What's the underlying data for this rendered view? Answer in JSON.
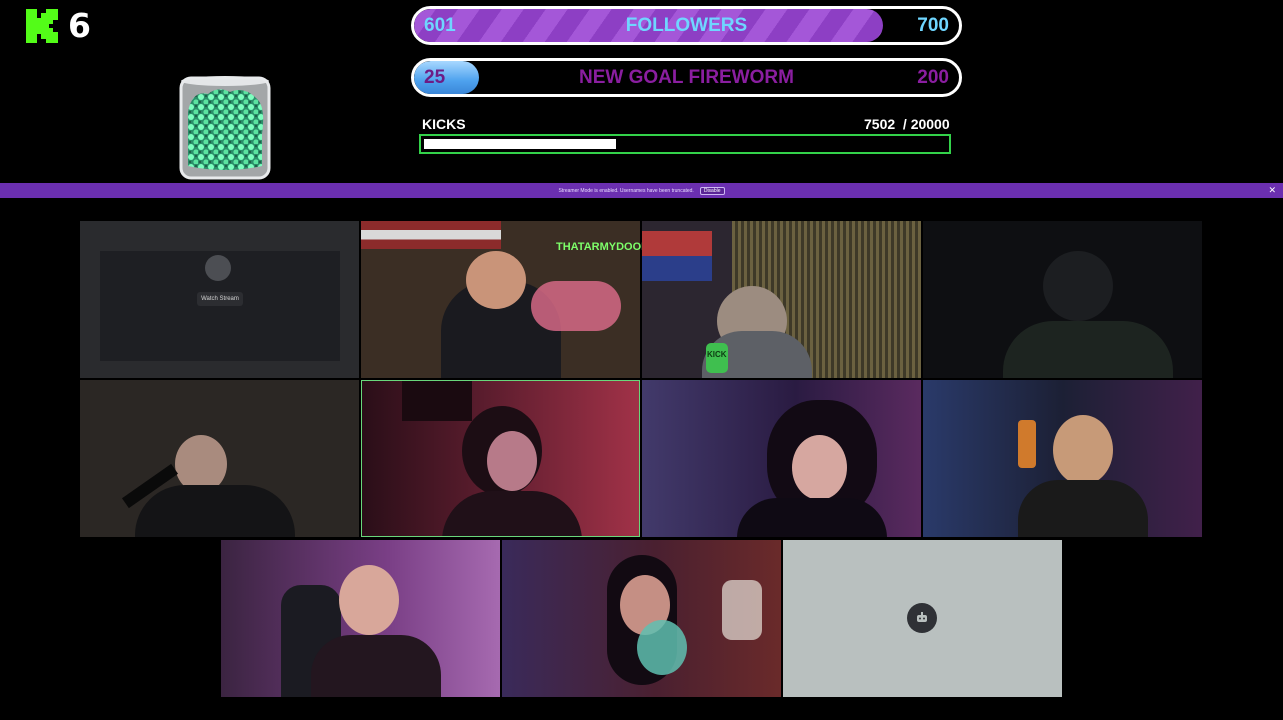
{
  "overlay": {
    "kick_count": "6",
    "followers": {
      "current": "601",
      "label": "FOLLOWERS",
      "goal": "700",
      "progress": 0.86
    },
    "fireworm": {
      "current": "25",
      "label": "NEW GOAL FIREWORM",
      "goal": "200",
      "progress": 0.12
    },
    "kicks": {
      "label": "KICKS",
      "value": "7502  / 20000",
      "progress": 0.375
    }
  },
  "banner": {
    "text": "Streamer Mode is enabled. Usernames have been truncated.",
    "button": "Disable"
  },
  "grid": {
    "watch_stream_label": "Watch Stream",
    "neon_sign": "THATARMYDOOD",
    "mic_label": "KICK"
  },
  "colors": {
    "kick_green": "#53fc18",
    "banner_purple": "#6b2fb0",
    "followers_fill": "#a457d8",
    "fireworm_fill": "#4ea2ee",
    "speaking_outline": "#69d77b"
  },
  "icons": {
    "kick": "kick-logo-icon",
    "close": "close-icon",
    "bot": "bot-avatar-icon"
  }
}
